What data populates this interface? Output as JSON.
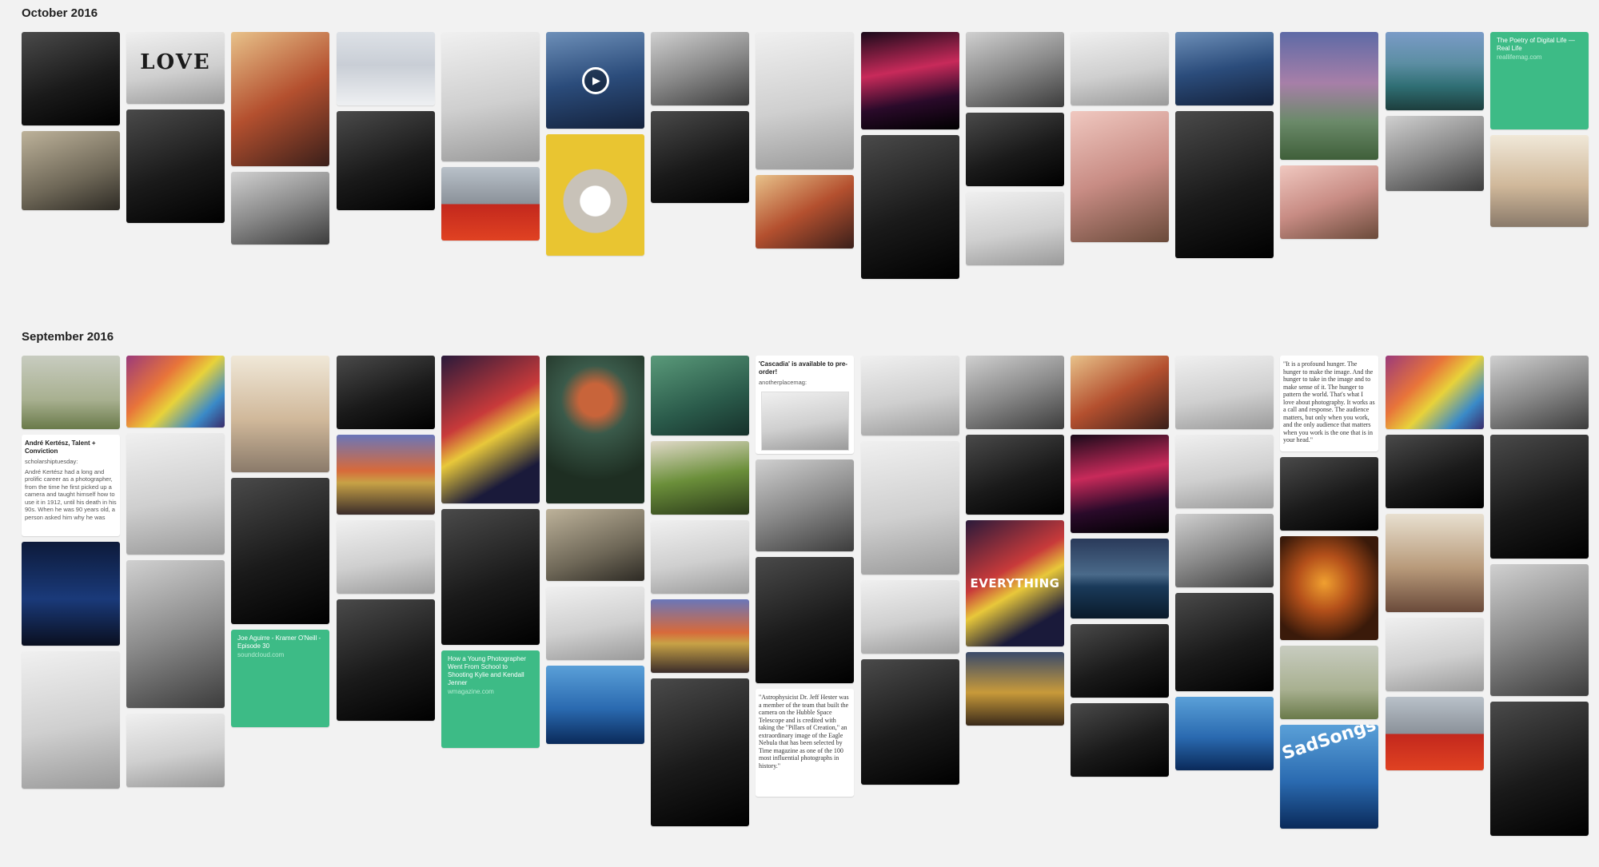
{
  "sections": [
    {
      "title": "October 2016",
      "columns": [
        {
          "tiles": [
            {
              "theme": "g-dark",
              "h": 117
            },
            {
              "theme": "g-sepia",
              "h": 99
            }
          ]
        },
        {
          "tiles": [
            {
              "theme": "g-light",
              "h": 90,
              "label": "LOVE"
            },
            {
              "theme": "g-dark",
              "h": 142
            }
          ]
        },
        {
          "tiles": [
            {
              "theme": "g-warm",
              "h": 168
            },
            {
              "theme": "g-mid",
              "h": 91
            }
          ]
        },
        {
          "tiles": [
            {
              "theme": "g-snow",
              "h": 92
            },
            {
              "theme": "g-dark",
              "h": 124
            }
          ]
        },
        {
          "tiles": [
            {
              "theme": "g-light",
              "h": 162
            },
            {
              "theme": "g-red",
              "h": 92
            }
          ]
        },
        {
          "tiles": [
            {
              "theme": "g-blue",
              "h": 121,
              "video": true
            },
            {
              "theme": "g-yellow",
              "h": 152
            }
          ]
        },
        {
          "tiles": [
            {
              "theme": "g-mid",
              "h": 92
            },
            {
              "theme": "g-dark",
              "h": 115
            }
          ]
        },
        {
          "tiles": [
            {
              "theme": "g-light",
              "h": 172
            },
            {
              "theme": "g-warm",
              "h": 92
            }
          ]
        },
        {
          "tiles": [
            {
              "theme": "g-neon",
              "h": 122
            },
            {
              "theme": "g-dark",
              "h": 180
            }
          ]
        },
        {
          "tiles": [
            {
              "theme": "g-mid",
              "h": 94
            },
            {
              "theme": "g-dark",
              "h": 92
            },
            {
              "theme": "g-light",
              "h": 92
            }
          ]
        },
        {
          "tiles": [
            {
              "theme": "g-light",
              "h": 92
            },
            {
              "theme": "g-pink",
              "h": 164
            }
          ]
        },
        {
          "tiles": [
            {
              "theme": "g-blue",
              "h": 92
            },
            {
              "theme": "g-dark",
              "h": 184
            }
          ]
        },
        {
          "tiles": [
            {
              "theme": "g-dusk",
              "h": 160
            },
            {
              "theme": "g-pink",
              "h": 92
            }
          ]
        },
        {
          "tiles": [
            {
              "theme": "g-teal",
              "h": 98
            },
            {
              "theme": "g-mid",
              "h": 94
            }
          ]
        },
        {
          "tiles": [
            {
              "theme": "link",
              "h": 122,
              "title": "The Poetry of Digital Life — Real Life",
              "url": "reallifemag.com"
            },
            {
              "theme": "g-vintage",
              "h": 115
            }
          ]
        }
      ]
    },
    {
      "title": "September 2016",
      "columns": [
        {
          "tiles": [
            {
              "theme": "g-fog",
              "h": 92
            },
            {
              "theme": "text",
              "h": 127,
              "title": "André Kertész, Talent + Conviction",
              "source": "scholarshiptuesday:",
              "body": "André Kertész had a long and prolific career as a photographer, from the time he first picked up a camera and taught himself how to use it in 1912, until his death in his 90s. When he was 90 years old, a person asked him why he was"
            },
            {
              "theme": "g-night",
              "h": 130
            },
            {
              "theme": "g-light",
              "h": 172
            }
          ]
        },
        {
          "tiles": [
            {
              "theme": "g-rainbow",
              "h": 90
            },
            {
              "theme": "g-light",
              "h": 152
            },
            {
              "theme": "g-mid",
              "h": 185
            },
            {
              "theme": "g-light",
              "h": 92
            }
          ]
        },
        {
          "tiles": [
            {
              "theme": "g-vintage",
              "h": 146
            },
            {
              "theme": "g-dark",
              "h": 183
            },
            {
              "theme": "link",
              "h": 122,
              "title": "Joe Aguirre - Kramer O'Neill - Episode 30",
              "url": "soundcloud.com"
            }
          ]
        },
        {
          "tiles": [
            {
              "theme": "g-dark",
              "h": 92
            },
            {
              "theme": "g-sunset",
              "h": 100
            },
            {
              "theme": "g-light",
              "h": 92
            },
            {
              "theme": "g-dark",
              "h": 152
            }
          ]
        },
        {
          "tiles": [
            {
              "theme": "g-abstract",
              "h": 185
            },
            {
              "theme": "g-dark",
              "h": 170
            },
            {
              "theme": "link",
              "h": 122,
              "title": "How a Young Photographer Went From School to Shooting Kylie and Kendall Jenner",
              "url": "wmagazine.com"
            }
          ]
        },
        {
          "tiles": [
            {
              "theme": "g-flower",
              "h": 185
            },
            {
              "theme": "g-sepia",
              "h": 90
            },
            {
              "theme": "g-light",
              "h": 92
            },
            {
              "theme": "g-ocean",
              "h": 98
            }
          ]
        },
        {
          "tiles": [
            {
              "theme": "g-green2",
              "h": 100
            },
            {
              "theme": "g-green",
              "h": 92
            },
            {
              "theme": "g-light",
              "h": 92
            },
            {
              "theme": "g-sunset",
              "h": 92
            },
            {
              "theme": "g-dark",
              "h": 185
            }
          ]
        },
        {
          "tiles": [
            {
              "theme": "text",
              "h": 123,
              "title": "'Cascadia' is available to pre-order!",
              "source": "anotherplacemag:",
              "thumb": true
            },
            {
              "theme": "g-mid",
              "h": 115
            },
            {
              "theme": "g-dark",
              "h": 158
            },
            {
              "theme": "text-serif",
              "h": 135,
              "body": "\"Astrophysicist Dr. Jeff Hester was a member of the team that built the camera on the Hubble Space Telescope and is credited with taking the \"Pillars of Creation,\" an extraordinary image of the Eagle Nebula that has been selected by Time magazine as one of the 100 most influential photographs in history.\""
            }
          ]
        },
        {
          "tiles": [
            {
              "theme": "g-light",
              "h": 100
            },
            {
              "theme": "g-light",
              "h": 167
            },
            {
              "theme": "g-light",
              "h": 92
            },
            {
              "theme": "g-dark",
              "h": 157
            }
          ]
        },
        {
          "tiles": [
            {
              "theme": "g-mid",
              "h": 92
            },
            {
              "theme": "g-dark",
              "h": 100
            },
            {
              "theme": "g-abstract",
              "h": 158,
              "overlay": "EVERYTHING"
            },
            {
              "theme": "g-gold",
              "h": 92
            }
          ]
        },
        {
          "tiles": [
            {
              "theme": "g-warm",
              "h": 92
            },
            {
              "theme": "g-neon",
              "h": 123
            },
            {
              "theme": "g-sea",
              "h": 100
            },
            {
              "theme": "g-dark",
              "h": 92
            },
            {
              "theme": "g-dark",
              "h": 92
            }
          ]
        },
        {
          "tiles": [
            {
              "theme": "g-light",
              "h": 92
            },
            {
              "theme": "g-light",
              "h": 92
            },
            {
              "theme": "g-mid",
              "h": 92
            },
            {
              "theme": "g-dark",
              "h": 123
            },
            {
              "theme": "g-ocean",
              "h": 92
            }
          ]
        },
        {
          "tiles": [
            {
              "theme": "text-serif",
              "h": 120,
              "body": "\"It is a profound hunger. The hunger to make the image. And the hunger to take in the image and to make sense of it. The hunger to pattern the world. That's what I love about photography. It works as a call and response. The audience matters, but only when you work, and the only audience that matters when you work is the one that is in your head.\""
            },
            {
              "theme": "g-dark",
              "h": 92
            },
            {
              "theme": "g-orange",
              "h": 130
            },
            {
              "theme": "g-fog",
              "h": 92
            },
            {
              "theme": "g-ocean",
              "h": 130,
              "overlay_top": "SadSongs"
            }
          ]
        },
        {
          "tiles": [
            {
              "theme": "g-rainbow",
              "h": 92
            },
            {
              "theme": "g-dark",
              "h": 92
            },
            {
              "theme": "g-office",
              "h": 123
            },
            {
              "theme": "g-light",
              "h": 92
            },
            {
              "theme": "g-red",
              "h": 92
            }
          ]
        },
        {
          "tiles": [
            {
              "theme": "g-mid",
              "h": 92
            },
            {
              "theme": "g-dark",
              "h": 155
            },
            {
              "theme": "g-mid",
              "h": 165
            },
            {
              "theme": "g-dark",
              "h": 168
            }
          ]
        }
      ]
    }
  ]
}
